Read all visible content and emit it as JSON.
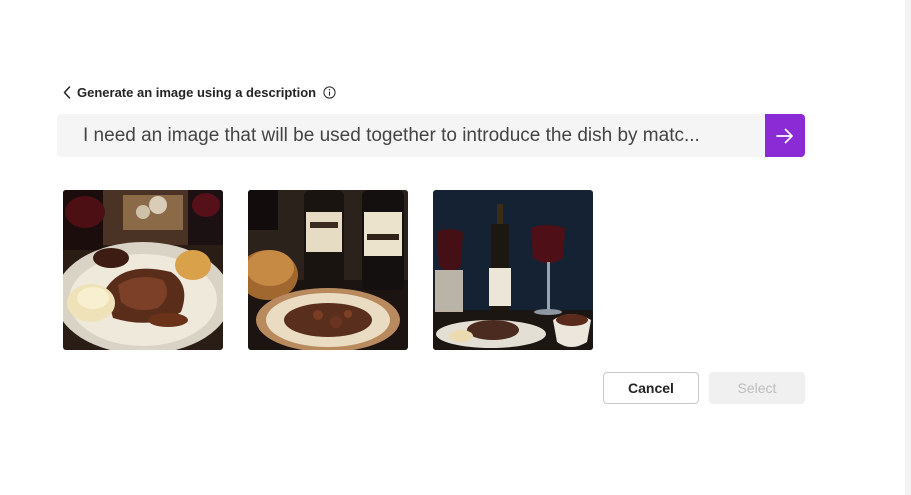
{
  "header": {
    "title": "Generate an image using a description",
    "back_icon": "chevron-left-icon",
    "info_icon": "info-icon"
  },
  "prompt": {
    "value": "I need an image that will be used together to introduce the dish by matc...",
    "submit_icon": "arrow-right-icon",
    "accent_color": "#8a2bd6"
  },
  "results": [
    {
      "id": "image-1",
      "description": "steak-with-mashed-potatoes-and-red-wine"
    },
    {
      "id": "image-2",
      "description": "wine-bottles-bread-and-beef-stew"
    },
    {
      "id": "image-3",
      "description": "red-wine-bottle-glasses-and-beef-dish"
    }
  ],
  "actions": {
    "cancel_label": "Cancel",
    "select_label": "Select"
  }
}
